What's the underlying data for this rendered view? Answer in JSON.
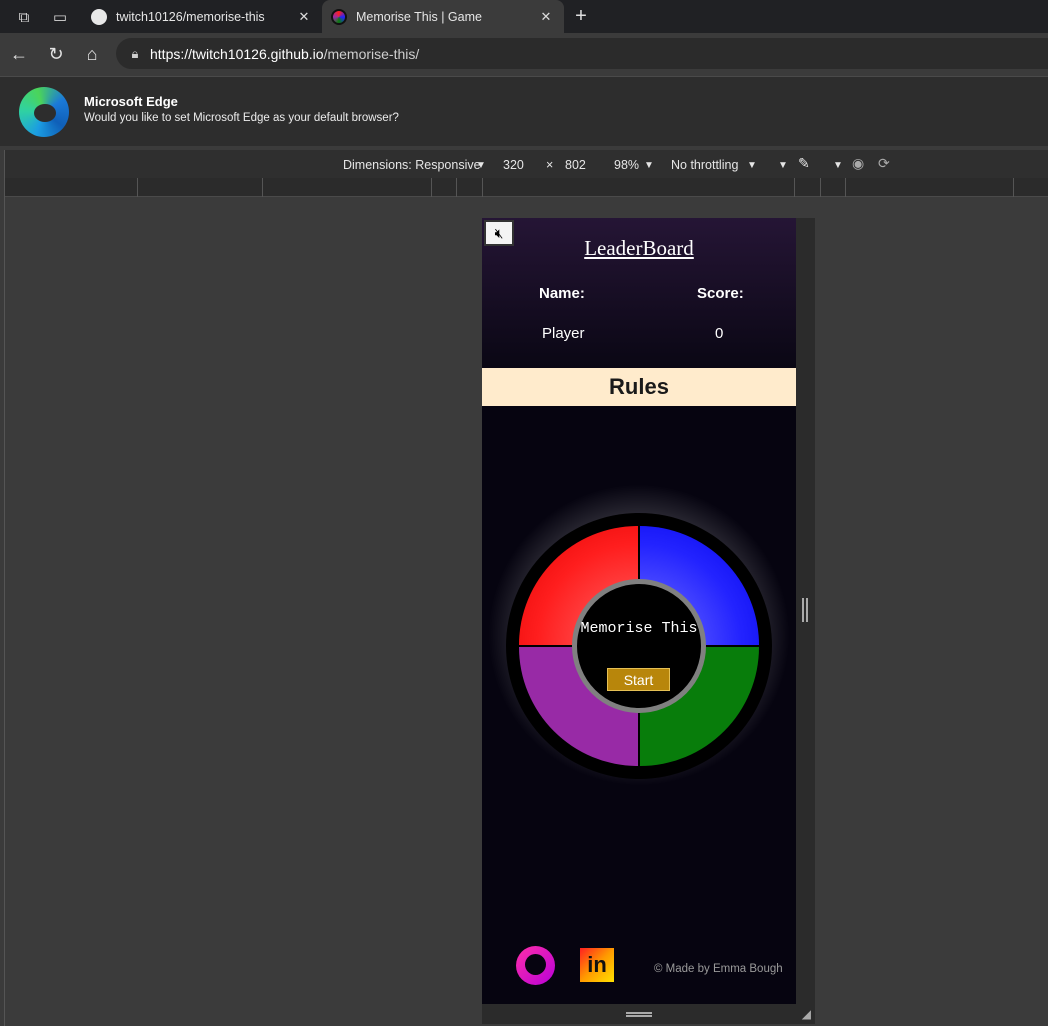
{
  "browser": {
    "tabs": [
      {
        "title": "twitch10126/memorise-this",
        "icon": "github-icon",
        "active": false
      },
      {
        "title": "Memorise This | Game",
        "icon": "site-favicon",
        "active": true
      }
    ],
    "url": {
      "host": "https://twitch10126.github.io",
      "path": "/memorise-this/"
    },
    "banner": {
      "title": "Microsoft Edge",
      "text": "Would you like to set Microsoft Edge as your default browser?"
    }
  },
  "devtools": {
    "dimensions_label": "Dimensions: Responsive",
    "width": "320",
    "times": "×",
    "height": "802",
    "zoom": "98%",
    "throttling": "No throttling"
  },
  "page": {
    "mute_icon": "speaker-muted-icon",
    "leaderboard": {
      "title": "LeaderBoard",
      "name_header": "Name:",
      "score_header": "Score:",
      "player": "Player",
      "score": "0"
    },
    "rules_label": "Rules",
    "game": {
      "title": "Memorise This",
      "start_label": "Start",
      "colors": {
        "red": "#ff1e1e",
        "blue": "#2323ff",
        "purple": "#982aa6",
        "green": "#087d0b"
      }
    },
    "footer": {
      "credit": "© Made by Emma Bough",
      "icons": [
        "github-icon",
        "linkedin-icon"
      ]
    }
  }
}
